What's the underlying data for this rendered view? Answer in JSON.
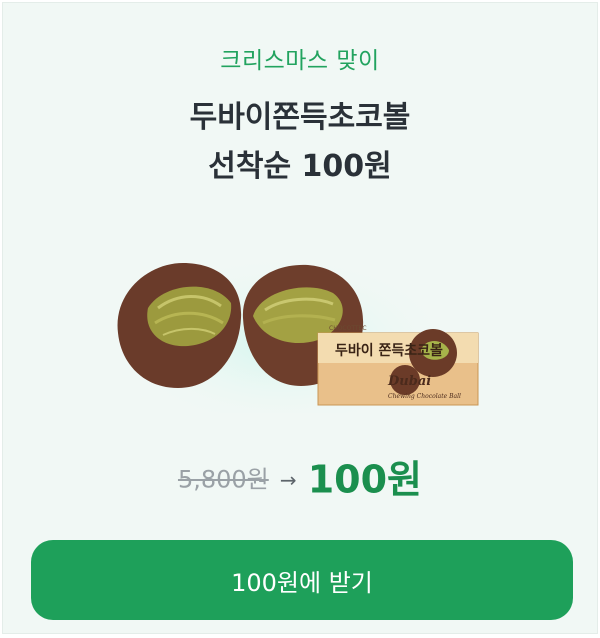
{
  "promo": {
    "kicker": "크리스마스 맞이",
    "title_line1": "두바이쫀득초코볼",
    "title_line2": "선착순 100원"
  },
  "product": {
    "box_label": "두바이 쫀득초코볼",
    "box_brand": "Dubai",
    "box_subtitle": "Chewing Chocolate Ball",
    "box_maker": "CHOCOTTEC"
  },
  "price": {
    "original": "5,800원",
    "arrow": "→",
    "sale": "100원"
  },
  "cta": {
    "label": "100원에 받기"
  },
  "colors": {
    "accent_green": "#1ea05a",
    "kicker_green": "#22a35f",
    "background": "#f1f8f5"
  }
}
